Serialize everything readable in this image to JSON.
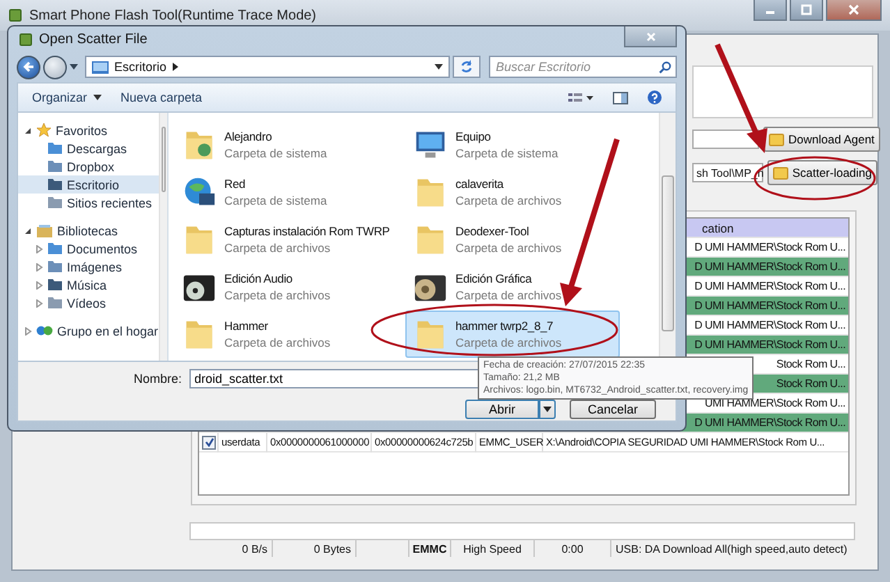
{
  "main_window": {
    "title": "Smart Phone Flash Tool(Runtime Trace Mode)",
    "scatter_path": "sh Tool\\MP_n",
    "buttons": [
      "Download Agent",
      "Scatter-loading"
    ],
    "table": {
      "header": "cation",
      "rows": [
        {
          "location": "D UMI HAMMER\\Stock Rom U..."
        },
        {
          "location": "D UMI HAMMER\\Stock Rom U..."
        },
        {
          "location": "D UMI HAMMER\\Stock Rom U..."
        },
        {
          "location": "D UMI HAMMER\\Stock Rom U..."
        },
        {
          "location": "D UMI HAMMER\\Stock Rom U..."
        },
        {
          "location": "D UMI HAMMER\\Stock Rom U..."
        },
        {
          "location": "Stock Rom U..."
        },
        {
          "location": "Stock Rom U..."
        },
        {
          "location": "UMI HAMMER\\Stock Rom U..."
        },
        {
          "location": "D UMI HAMMER\\Stock Rom U..."
        }
      ],
      "full_row": {
        "checked": true,
        "name": "userdata",
        "begin": "0x0000000061000000",
        "end": "0x00000000624c725b",
        "region": "EMMC_USER",
        "location": "X:\\Android\\COPIA SEGURIDAD UMI HAMMER\\Stock Rom U..."
      }
    },
    "progress": {
      "level": 0
    },
    "status_bar": [
      "0 B/s",
      "0 Bytes",
      "EMMC",
      "High Speed",
      "0:00",
      "USB: DA Download All(high speed,auto detect)"
    ]
  },
  "dialog": {
    "title": "Open Scatter File",
    "breadcrumb": "Escritorio",
    "search_placeholder": "Buscar Escritorio",
    "toolbar": [
      "Organizar",
      "Nueva carpeta"
    ],
    "nav": [
      {
        "label": "Favoritos",
        "expanded": true,
        "selected": false,
        "children": [
          {
            "label": "Descargas",
            "selected": false
          },
          {
            "label": "Dropbox",
            "selected": false
          },
          {
            "label": "Escritorio",
            "selected": true
          },
          {
            "label": "Sitios recientes",
            "selected": false
          }
        ]
      },
      {
        "label": "Bibliotecas",
        "expanded": true,
        "selected": false,
        "children": [
          {
            "label": "Documentos",
            "expanded": false,
            "selected": false
          },
          {
            "label": "Imágenes",
            "expanded": false,
            "selected": false
          },
          {
            "label": "Música",
            "expanded": false,
            "selected": false
          },
          {
            "label": "Vídeos",
            "expanded": false,
            "selected": false
          }
        ]
      },
      {
        "label": "Grupo en el hogar",
        "expanded": false,
        "selected": false
      }
    ],
    "files": [
      {
        "name": "Alejandro",
        "type": "Carpeta de sistema",
        "kind": "user",
        "selected": false
      },
      {
        "name": "Equipo",
        "type": "Carpeta de sistema",
        "kind": "computer",
        "selected": false
      },
      {
        "name": "Red",
        "type": "Carpeta de sistema",
        "kind": "network",
        "selected": false
      },
      {
        "name": "calaverita",
        "type": "Carpeta de archivos",
        "kind": "folder",
        "selected": false
      },
      {
        "name": "Capturas instalación Rom TWRP",
        "type": "Carpeta de archivos",
        "kind": "folder",
        "selected": false
      },
      {
        "name": "Deodexer-Tool",
        "type": "Carpeta de archivos",
        "kind": "folder",
        "selected": false
      },
      {
        "name": "Edición Audio",
        "type": "Carpeta de archivos",
        "kind": "media",
        "selected": false
      },
      {
        "name": "Edición Gráfica",
        "type": "Carpeta de archivos",
        "kind": "film",
        "selected": false
      },
      {
        "name": "Hammer",
        "type": "Carpeta de archivos",
        "kind": "folder",
        "selected": false
      },
      {
        "name": "hammer twrp2_8_7",
        "type": "Carpeta de archivos",
        "kind": "folder",
        "selected": true
      }
    ],
    "filename_label": "Nombre:",
    "filename": "droid_scatter.txt",
    "buttons": [
      "Abrir",
      "Cancelar"
    ],
    "tooltip": [
      "Fecha de creación: 27/07/2015 22:35",
      "Tamaño: 21,2 MB",
      "Archivos: logo.bin, MT6732_Android_scatter.txt, recovery.img"
    ]
  }
}
